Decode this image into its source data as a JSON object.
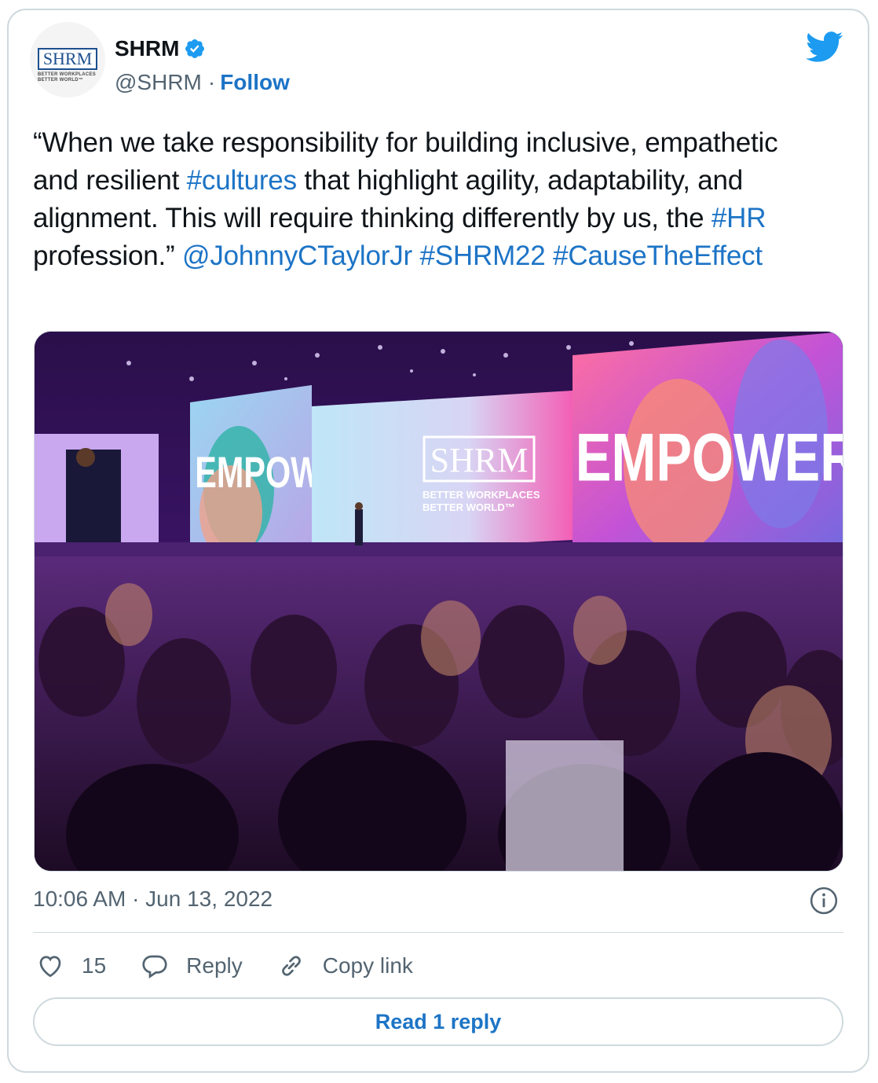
{
  "author": {
    "name": "SHRM",
    "handle": "@SHRM",
    "separator": "·",
    "follow_label": "Follow",
    "verified_icon": "verified-badge-icon",
    "avatar_logo_text": "SHRM",
    "avatar_logo_sub": "BETTER WORKPLACES BETTER WORLD™"
  },
  "tweet": {
    "segments": [
      {
        "text": "“When we take responsibility for building inclusive, empathetic and resilient ",
        "link": false
      },
      {
        "text": "#cultures",
        "link": true
      },
      {
        "text": " that highlight agility, adaptability, and alignment. This will require thinking differently by us, the ",
        "link": false
      },
      {
        "text": "#HR",
        "link": true
      },
      {
        "text": " profession.” ",
        "link": false
      },
      {
        "text": "@JohnnyCTaylorJr",
        "link": true
      },
      {
        "text": " ",
        "link": false
      },
      {
        "text": "#SHRM22",
        "link": true
      },
      {
        "text": " ",
        "link": false
      },
      {
        "text": "#CauseTheEffect",
        "link": true
      }
    ]
  },
  "photo": {
    "screen_word_left": "EMPOWER",
    "screen_word_right": "EMPOWER",
    "center_logo": "SHRM",
    "center_tagline_1": "BETTER WORKPLACES",
    "center_tagline_2": "BETTER WORLD™"
  },
  "meta": {
    "timestamp": "10:06 AM · Jun 13, 2022"
  },
  "actions": {
    "likes_count": "15",
    "reply_label": "Reply",
    "copy_link_label": "Copy link",
    "read_replies_label": "Read 1 reply"
  },
  "colors": {
    "link": "#1d74c6",
    "twitter_blue": "#1d9bf0",
    "muted": "#536471",
    "border": "#cfd9de"
  }
}
